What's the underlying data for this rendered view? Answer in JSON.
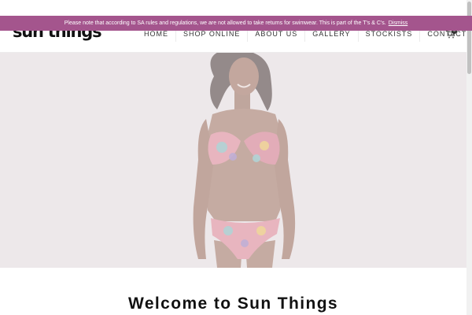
{
  "notice": {
    "message": "Please note that according to SA rules and regulations, we are not allowed to take returns for swimwear.  This is part of the T's & C's.",
    "dismiss_label": "Dismiss",
    "background_color": "#a4558d"
  },
  "header": {
    "logo_text": "sun things",
    "nav": [
      {
        "label": "HOME"
      },
      {
        "label": "SHOP ONLINE"
      },
      {
        "label": "ABOUT US"
      },
      {
        "label": "GALLERY"
      },
      {
        "label": "STOCKISTS"
      },
      {
        "label": "CONTACT US"
      }
    ],
    "cart_icon": "shopping-cart-icon",
    "cart_count": "0"
  },
  "hero": {
    "image": "model-in-floral-bikini",
    "background_color": "#ede8ea"
  },
  "welcome": {
    "heading": "Welcome to Sun Things"
  }
}
